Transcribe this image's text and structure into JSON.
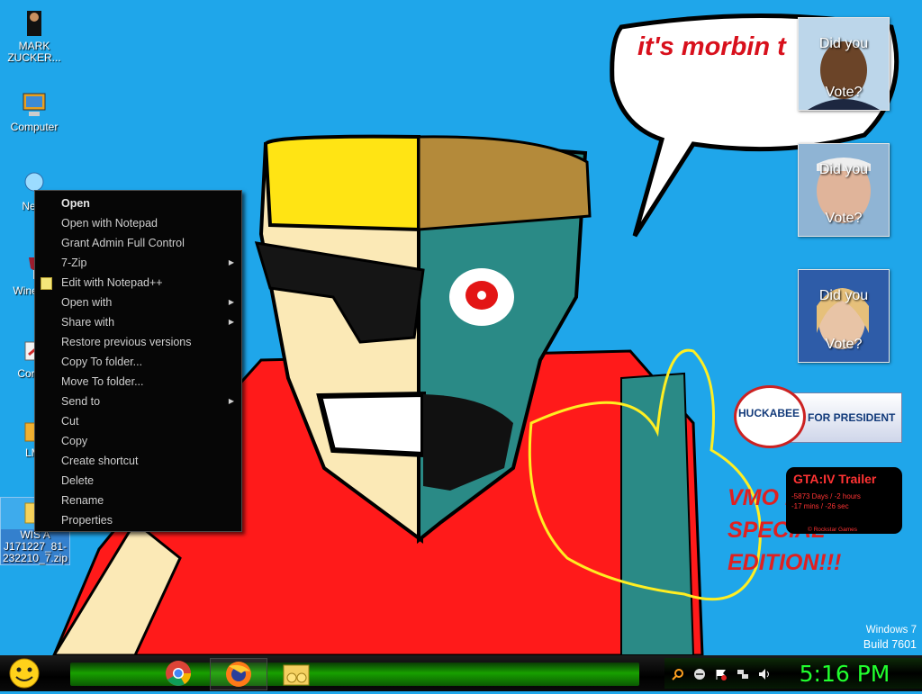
{
  "desktop": {
    "icons": [
      {
        "label": "MARK ZUCKER...",
        "icon": "person-icon"
      },
      {
        "label": "Computer",
        "icon": "computer-icon"
      },
      {
        "label": "Netw",
        "icon": "network-icon"
      },
      {
        "label": "Wine Vis",
        "icon": "wine-icon"
      },
      {
        "label": "Cor Pa",
        "icon": "control-panel-icon"
      },
      {
        "label": "LMI",
        "icon": "folder-icon"
      },
      {
        "label": "WIS A J171227_81-232210_7.zip",
        "icon": "zip-folder-icon"
      }
    ]
  },
  "wallpaper": {
    "speech_bubble_text": "it's morbin t",
    "red_text": "VMO MOR SPECIAL EDITION!!!"
  },
  "context_menu": {
    "items": [
      {
        "label": "Open",
        "bold": true,
        "submenu": false
      },
      {
        "label": "Open with Notepad",
        "submenu": false
      },
      {
        "label": "Grant Admin Full Control",
        "submenu": false
      },
      {
        "label": "7-Zip",
        "submenu": true
      },
      {
        "label": "Edit with Notepad++",
        "submenu": false,
        "icon": "notepad-plus-icon"
      },
      {
        "label": "Open with",
        "submenu": true
      },
      {
        "label": "Share with",
        "submenu": true
      },
      {
        "label": "Restore previous versions",
        "submenu": false
      },
      {
        "label": "Copy To folder...",
        "submenu": false
      },
      {
        "label": "Move To folder...",
        "submenu": false
      },
      {
        "label": "Send to",
        "submenu": true
      },
      {
        "label": "Cut",
        "submenu": false
      },
      {
        "label": "Copy",
        "submenu": false
      },
      {
        "label": "Create shortcut",
        "submenu": false
      },
      {
        "label": "Delete",
        "submenu": false
      },
      {
        "label": "Rename",
        "submenu": false
      },
      {
        "label": "Properties",
        "submenu": false
      }
    ]
  },
  "gadgets": {
    "votes": [
      {
        "line1": "Did you",
        "line2": "Vote?"
      },
      {
        "line1": "Did you",
        "line2": "Vote?"
      },
      {
        "line1": "Did you",
        "line2": "Vote?"
      }
    ],
    "huckabee": {
      "name": "HUCKABEE",
      "slogan": "FOR PRESIDENT"
    },
    "gta": {
      "title": "GTA:IV Trailer",
      "line1": "-5873 Days / -2 hours",
      "line2": "-17 mins / -26 sec",
      "credit": "© Rockstar Games"
    }
  },
  "watermark": {
    "line1": "Windows 7",
    "line2": "Build 7601"
  },
  "taskbar": {
    "start_icon": "smiley-start-icon",
    "pinned": [
      {
        "name": "chrome-icon",
        "active": false
      },
      {
        "name": "firefox-icon",
        "active": true
      },
      {
        "name": "explorer-icon",
        "active": false
      }
    ],
    "tray_icons": [
      "search-icon",
      "messenger-icon",
      "action-center-icon",
      "network-tray-icon",
      "volume-icon"
    ],
    "clock": "5:16 PM"
  }
}
